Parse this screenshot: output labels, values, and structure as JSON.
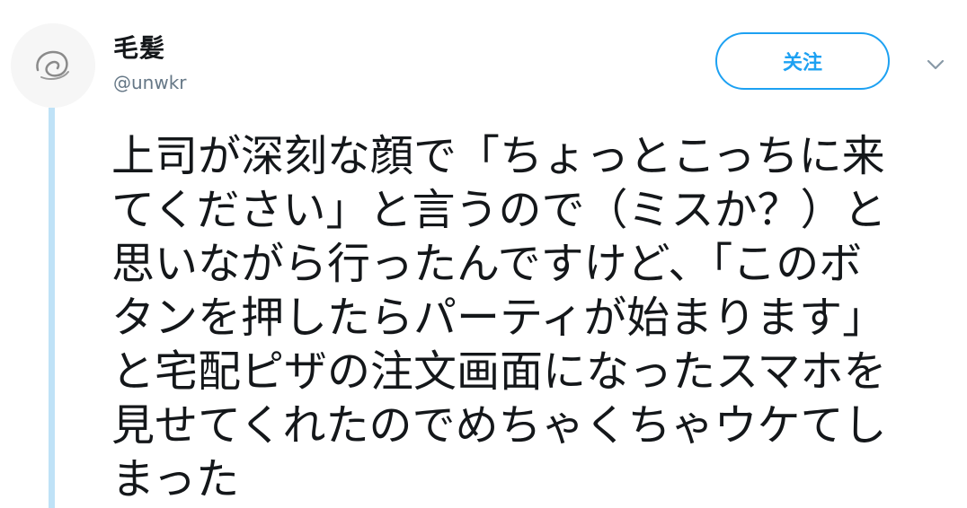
{
  "author": {
    "display_name": "毛髪",
    "handle": "@unwkr",
    "avatar_icon": "avatar-scribble-icon"
  },
  "actions": {
    "follow_label": "关注",
    "menu_icon": "chevron-down-icon"
  },
  "colors": {
    "accent": "#1da1f2",
    "thread_line": "#bfe2f7",
    "text": "#14171a",
    "secondary_text": "#657786"
  },
  "tweet": {
    "lines": [
      "上司が深刻な顔で「ちょっとこっちに来",
      "てください」と言うので（ミスか？）と",
      "思いながら行ったんですけど、「このボ",
      "タンを押したらパーティが始まります」",
      "と宅配ピザの注文画面になったスマホを",
      "見せてくれたのでめちゃくちゃウケてし",
      "まった"
    ]
  }
}
